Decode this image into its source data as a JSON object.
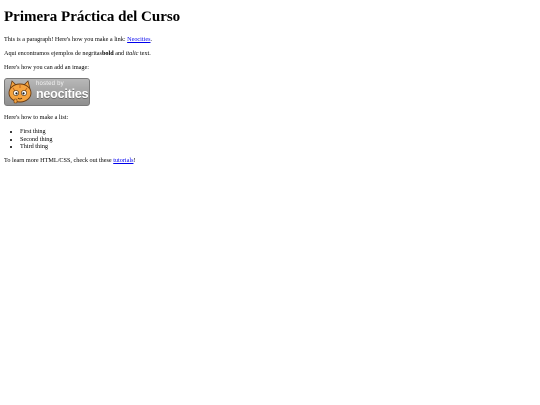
{
  "page": {
    "title": "Primera Práctica del Curso",
    "paragraph1": {
      "before_link": "This is a paragraph! Here's how you make a link: ",
      "link_text": "Neocities",
      "after_link": "."
    },
    "paragraph2": {
      "before_bold": "Aqui encontramos ejemplos de negritas",
      "bold_text": "bold",
      "between": " and ",
      "italic_text": "italic",
      "after_italic": " text."
    },
    "image_intro": "Here's how you can add an image:",
    "badge": {
      "hosted_text": "hosted by",
      "brand_text": "neocities",
      "icon": "neocities-cat-icon"
    },
    "list_intro": "Here's how to make a list:",
    "list_items": [
      "First thing",
      "Second thing",
      "Third thing"
    ],
    "footer": {
      "before_link": "To learn more HTML/CSS, check out these ",
      "link_text": "tutorials",
      "after_link": "!"
    }
  },
  "colors": {
    "link": "#0000ee",
    "badge_background": "#a8a8a8",
    "cat_orange": "#f4a340"
  }
}
